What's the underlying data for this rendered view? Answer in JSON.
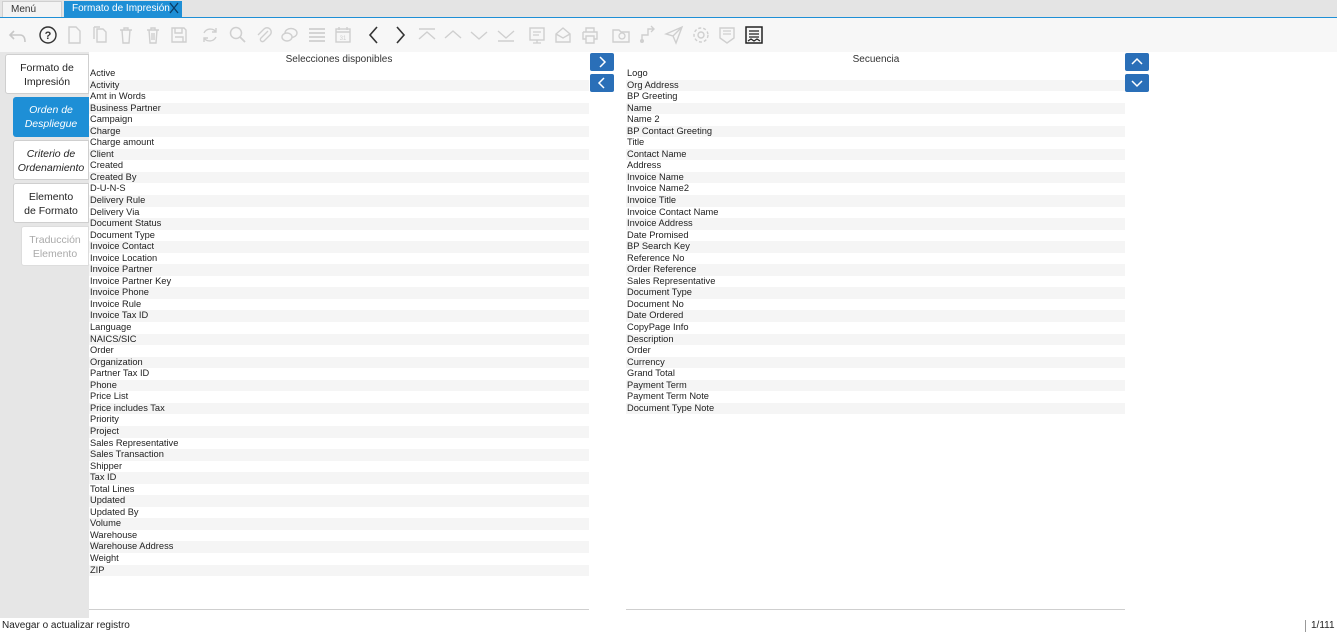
{
  "tabs": {
    "menu_label": "Menú (12)",
    "active_label": "Formato de Impresión"
  },
  "toolbar": {
    "icons": [
      "undo-icon",
      "help-icon",
      "new-record-icon",
      "copy-record-icon",
      "delete-icon",
      "delete-selection-icon",
      "save-icon",
      "refresh-icon",
      "find-icon",
      "attachment-icon",
      "chat-icon",
      "grid-toggle-icon",
      "calendar-icon",
      "previous-arrow-icon",
      "next-arrow-icon",
      "first-record-icon",
      "previous-record-icon",
      "next-record-icon",
      "last-record-icon",
      "report-icon",
      "archive-icon",
      "print-icon",
      "zoom-across-icon",
      "workflow-icon",
      "send-icon",
      "process-icon",
      "product-info-icon",
      "print-preview-icon"
    ]
  },
  "left_tabs": [
    {
      "line1": "Formato de",
      "line2": "Impresión"
    },
    {
      "line1": "Orden de",
      "line2": "Despliegue"
    },
    {
      "line1": "Criterio de",
      "line2": "Ordenamiento"
    },
    {
      "line1": "Elemento",
      "line2": "de Formato"
    },
    {
      "line1": "Traducción",
      "line2": "Elemento"
    }
  ],
  "available": {
    "title": "Selecciones disponibles",
    "items": [
      "Active",
      "Activity",
      "Amt in Words",
      "Business Partner",
      "Campaign",
      "Charge",
      "Charge amount",
      "Client",
      "Created",
      "Created By",
      "D-U-N-S",
      "Delivery Rule",
      "Delivery Via",
      "Document Status",
      "Document Type",
      "Invoice Contact",
      "Invoice Location",
      "Invoice Partner",
      "Invoice Partner Key",
      "Invoice Phone",
      "Invoice Rule",
      "Invoice Tax ID",
      "Language",
      "NAICS/SIC",
      "Order",
      "Organization",
      "Partner Tax ID",
      "Phone",
      "Price List",
      "Price includes Tax",
      "Priority",
      "Project",
      "Sales Representative",
      "Sales Transaction",
      "Shipper",
      "Tax ID",
      "Total Lines",
      "Updated",
      "Updated By",
      "Volume",
      "Warehouse",
      "Warehouse Address",
      "Weight",
      "ZIP"
    ]
  },
  "sequence": {
    "title": "Secuencia",
    "items": [
      "Logo",
      "Org Address",
      "BP Greeting",
      "Name",
      "Name 2",
      "BP Contact Greeting",
      "Title",
      "Contact Name",
      "Address",
      "Invoice Name",
      "Invoice Name2",
      "Invoice Title",
      "Invoice Contact Name",
      "Invoice Address",
      "Date Promised",
      "BP Search Key",
      "Reference No",
      "Order Reference",
      "Sales Representative",
      "Document Type",
      "Document No",
      "Date Ordered",
      "CopyPage Info",
      "Description",
      "Order",
      "Currency",
      "Grand Total",
      "Payment Term",
      "Payment Term Note",
      "Document Type Note"
    ]
  },
  "status": {
    "text": "Navegar o actualizar registro",
    "count": "1/111"
  },
  "colors": {
    "accent": "#1e8fd6",
    "button": "#2a6fb8"
  }
}
